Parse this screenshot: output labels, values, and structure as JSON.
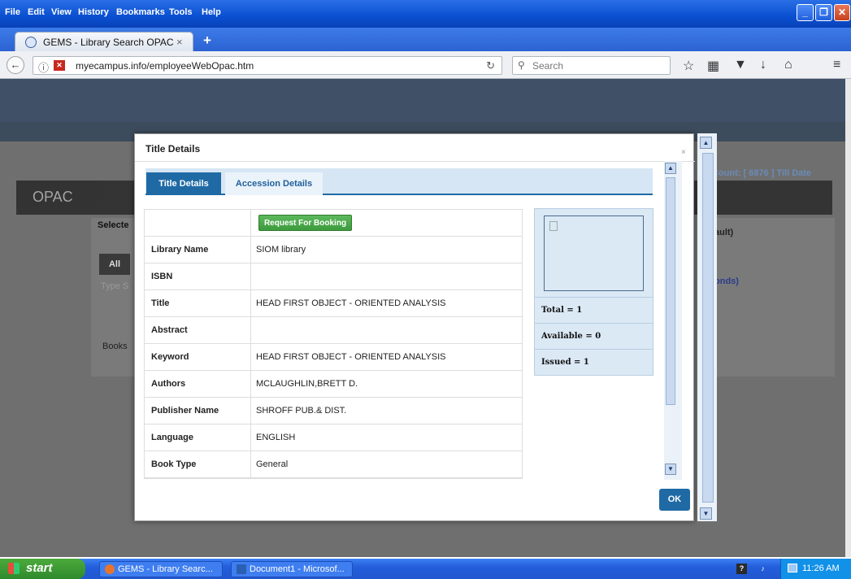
{
  "menu": {
    "items": [
      "File",
      "Edit",
      "View",
      "History",
      "Bookmarks",
      "Tools",
      "Help"
    ]
  },
  "window_controls": {
    "minimize": "_",
    "restore": "❐",
    "close": "✕"
  },
  "browser": {
    "tab_title": "GEMS - Library Search OPAC",
    "tab_close": "×",
    "new_tab": "+",
    "url": "myecampus.info/employeeWebOpac.htm",
    "search_placeholder": "Search"
  },
  "background": {
    "opac_label": "OPAC",
    "count_label": "Count: [ 6876 ] Till Date",
    "selected_label": "Selecte",
    "all_tab": "All",
    "type_placeholder": "Type S",
    "books_label": "Books",
    "default_label": "ault)",
    "bonds_label": "onds)"
  },
  "modal": {
    "title": "Title Details",
    "close": "×",
    "tabs": [
      "Title Details",
      "Accession Details"
    ],
    "booking_button": "Request For Booking",
    "rows": [
      {
        "label": "Library Name",
        "value": "SIOM library"
      },
      {
        "label": "ISBN",
        "value": ""
      },
      {
        "label": "Title",
        "value": "HEAD FIRST OBJECT - ORIENTED ANALYSIS"
      },
      {
        "label": "Abstract",
        "value": ""
      },
      {
        "label": "Keyword",
        "value": "HEAD FIRST OBJECT - ORIENTED ANALYSIS"
      },
      {
        "label": "Authors",
        "value": "MCLAUGHLIN,BRETT D."
      },
      {
        "label": "Publisher Name",
        "value": "SHROFF PUB.& DIST."
      },
      {
        "label": "Language",
        "value": "ENGLISH"
      },
      {
        "label": "Book Type",
        "value": "General"
      }
    ],
    "stats": {
      "total": "Total = 1",
      "available": "Available = 0",
      "issued": "Issued = 1"
    },
    "ok_button": "OK"
  },
  "taskbar": {
    "start": "start",
    "tasks": [
      "GEMS - Library Searc...",
      "Document1 - Microsof..."
    ],
    "clock": "11:26 AM"
  },
  "colors": {
    "xp_blue": "#245edb",
    "tab_active": "#1f6aa5",
    "booking_green": "#4cae4c",
    "start_green": "#3c9a34"
  }
}
